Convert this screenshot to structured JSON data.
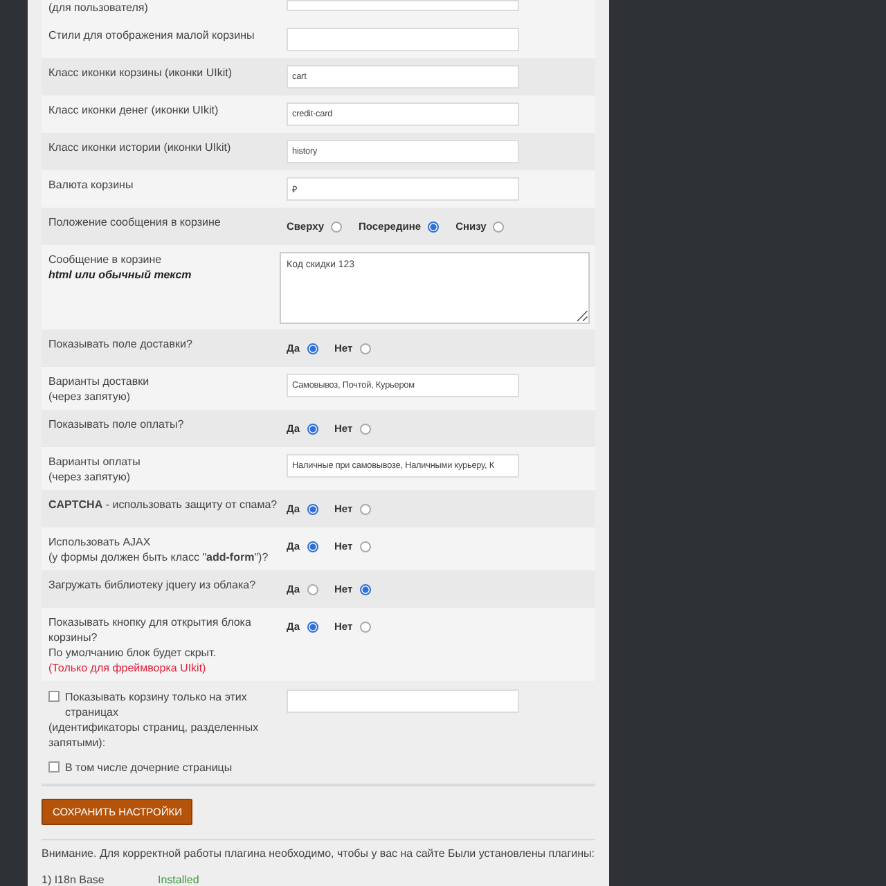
{
  "rows": [
    {
      "kind": "input",
      "lines": [
        "(для пользователя)"
      ]
    },
    {
      "kind": "input",
      "lines": [
        "Стили для отображения малой корзины"
      ]
    },
    {
      "kind": "input",
      "lines": [
        "Класс иконки корзины (иконки UIkit)"
      ],
      "value": "cart"
    },
    {
      "kind": "input",
      "lines": [
        "Класс иконки денег (иконки UIkit)"
      ],
      "value": "credit-card"
    },
    {
      "kind": "input",
      "lines": [
        "Класс иконки истории (иконки UIkit)"
      ],
      "value": "history"
    },
    {
      "kind": "input",
      "lines": [
        "Валюта корзины"
      ],
      "value": "₽"
    },
    {
      "kind": "radio",
      "lines": [
        "Положение сообщения в корзине"
      ],
      "options": [
        {
          "label": "Сверху",
          "selected": false
        },
        {
          "label": "Посередине",
          "selected": true
        },
        {
          "label": "Снизу",
          "selected": false
        }
      ]
    },
    {
      "kind": "textarea",
      "lines": [
        "Сообщение в корзине"
      ],
      "hint": "html или обычный текст",
      "value": "Код скидки 123"
    },
    {
      "kind": "radio",
      "lines": [
        "Показывать поле доставки?"
      ],
      "options": [
        {
          "label": "Да",
          "selected": true
        },
        {
          "label": "Нет",
          "selected": false
        }
      ]
    },
    {
      "kind": "input",
      "lines": [
        "Варианты доставки",
        "(через запятую)"
      ],
      "value": "Самовывоз, Почтой, Курьером"
    },
    {
      "kind": "radio",
      "lines": [
        "Показывать поле оплаты?"
      ],
      "options": [
        {
          "label": "Да",
          "selected": true
        },
        {
          "label": "Нет",
          "selected": false
        }
      ]
    },
    {
      "kind": "input",
      "lines": [
        "Варианты оплаты",
        "(через запятую)"
      ],
      "value": "Наличные при самовывозе, Наличными курьеру, К"
    },
    {
      "kind": "radio",
      "lines": [
        "**CAPTCHA** - использовать защиту от спама?"
      ],
      "options": [
        {
          "label": "Да",
          "selected": true
        },
        {
          "label": "Нет",
          "selected": false
        }
      ]
    },
    {
      "kind": "radio",
      "lines": [
        "Использовать AJAX",
        "(у формы должен быть класс \"**add-form**\")?"
      ],
      "options": [
        {
          "label": "Да",
          "selected": true
        },
        {
          "label": "Нет",
          "selected": false
        }
      ]
    },
    {
      "kind": "radio",
      "lines": [
        "Загружать библиотеку jquery из облака?"
      ],
      "options": [
        {
          "label": "Да",
          "selected": false
        },
        {
          "label": "Нет",
          "selected": true
        }
      ]
    },
    {
      "kind": "radio",
      "lines": [
        "Показывать кнопку для открытия блока корзины?",
        "По умолчанию блок будет скрыт."
      ],
      "note": "(Только для фреймворка UIkit)",
      "options": [
        {
          "label": "Да",
          "selected": true
        },
        {
          "label": "Нет",
          "selected": false
        }
      ]
    }
  ],
  "pages_option": {
    "checkbox": {
      "label": "Показывать корзину только на этих страницах",
      "checked": false
    },
    "hint": "(идентификаторы страниц, разделенных запятыми):",
    "children_checkbox": {
      "label": "В том числе дочерние страницы",
      "checked": false
    }
  },
  "save_button": "СОХРАНИТЬ НАСТРОЙКИ",
  "notice": "Внимание. Для корректной работы плагина необходимо, чтобы у вас на сайте Были установлены плагины:",
  "plugins": [
    {
      "name": "1) I18n Base",
      "status": "Installed"
    }
  ]
}
